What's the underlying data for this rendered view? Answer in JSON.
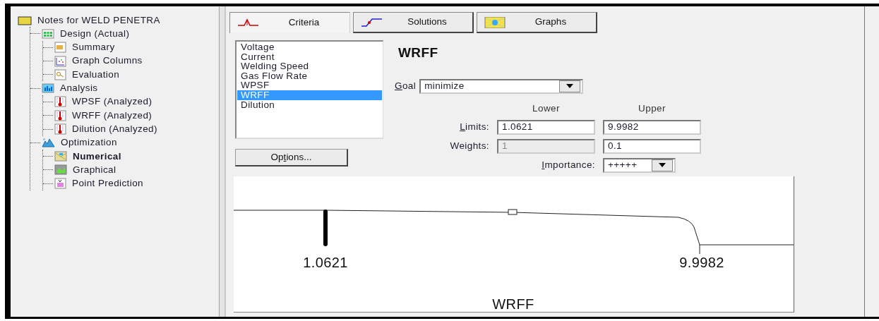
{
  "tree": {
    "label": "Notes for WELD PENETRA",
    "kind": "folder",
    "selected": false,
    "children": [
      {
        "label": "Design (Actual)",
        "kind": "design",
        "selected": false,
        "children": [
          {
            "label": "Summary",
            "kind": "summary",
            "selected": false
          },
          {
            "label": "Graph Columns",
            "kind": "graph",
            "selected": false
          },
          {
            "label": "Evaluation",
            "kind": "evaluation",
            "selected": false
          }
        ]
      },
      {
        "label": "Analysis",
        "kind": "analysis",
        "selected": false,
        "children": [
          {
            "label": "WPSF (Analyzed)",
            "kind": "response",
            "selected": false
          },
          {
            "label": "WRFF (Analyzed)",
            "kind": "response",
            "selected": false
          },
          {
            "label": "Dilution (Analyzed)",
            "kind": "response",
            "selected": false
          }
        ]
      },
      {
        "label": "Optimization",
        "kind": "optimization",
        "selected": false,
        "children": [
          {
            "label": "Numerical",
            "kind": "numerical",
            "selected": true
          },
          {
            "label": "Graphical",
            "kind": "graphical",
            "selected": false
          },
          {
            "label": "Point Prediction",
            "kind": "prediction",
            "selected": false
          }
        ]
      }
    ]
  },
  "tabs": [
    {
      "label": "Criteria",
      "kind": "criteria",
      "selected": true
    },
    {
      "label": "Solutions",
      "kind": "solutions",
      "selected": false
    },
    {
      "label": "Graphs",
      "kind": "graphs",
      "selected": false
    }
  ],
  "responses": [
    {
      "label": "Voltage",
      "selected": false
    },
    {
      "label": "Current",
      "selected": false
    },
    {
      "label": "Welding Speed",
      "selected": false
    },
    {
      "label": "Gas Flow Rate",
      "selected": false
    },
    {
      "label": "WPSF",
      "selected": false
    },
    {
      "label": "WRFF",
      "selected": true
    },
    {
      "label": "Dilution",
      "selected": false
    }
  ],
  "options_button": [
    {
      "text": "Op",
      "underline": false
    },
    {
      "text": "t",
      "underline": true
    },
    {
      "text": "ions...",
      "underline": false
    }
  ],
  "title": "WRFF",
  "goal": {
    "label": [
      {
        "text": "G",
        "underline": true
      },
      {
        "text": "oal",
        "underline": false
      }
    ],
    "value": "minimize"
  },
  "columns": [
    "Lower",
    "Upper"
  ],
  "rows": [
    {
      "label": [
        {
          "text": "L",
          "underline": true
        },
        {
          "text": "imits:",
          "underline": false
        }
      ],
      "lower": "1.0621",
      "upper": "9.9982",
      "lower_disabled": false
    },
    {
      "label": [
        {
          "text": "Weights:",
          "underline": false
        }
      ],
      "lower": "1",
      "upper": "0.1",
      "lower_disabled": true
    }
  ],
  "importance": {
    "label": [
      {
        "text": "I",
        "underline": true
      },
      {
        "text": "mportance:",
        "underline": false
      }
    ],
    "value": "+++++"
  },
  "desirability_plot": {
    "lower_label": "1.0621",
    "upper_label": "9.9982",
    "axis_title": "WRFF"
  }
}
